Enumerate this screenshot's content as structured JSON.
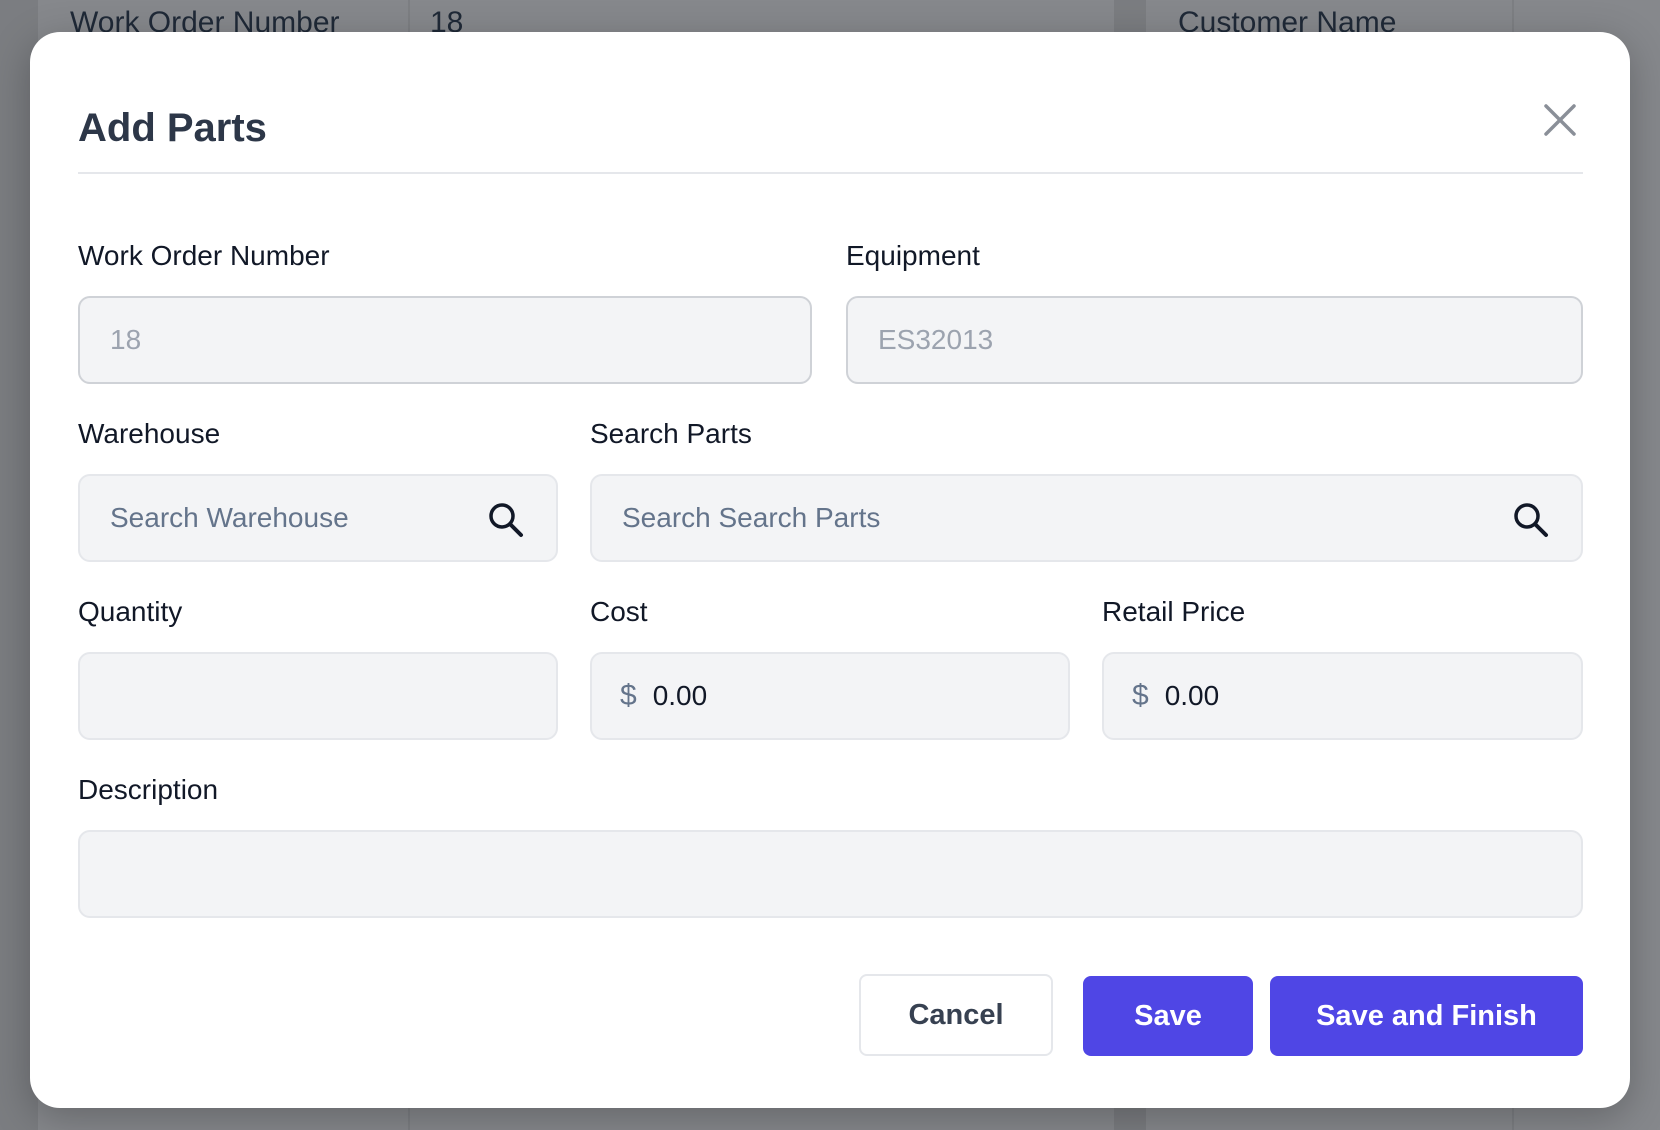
{
  "background": {
    "left_label": "Work Order Number",
    "left_value": "18",
    "right_label": "Customer Name"
  },
  "modal": {
    "title": "Add Parts",
    "close_icon": "close-icon",
    "fields": {
      "work_order_number": {
        "label": "Work Order Number",
        "value": "18",
        "disabled": true
      },
      "equipment": {
        "label": "Equipment",
        "value": "ES32013",
        "disabled": true
      },
      "warehouse": {
        "label": "Warehouse",
        "placeholder": "Search Warehouse",
        "icon": "search-icon"
      },
      "search_parts": {
        "label": "Search Parts",
        "placeholder": "Search Search Parts",
        "icon": "search-icon"
      },
      "quantity": {
        "label": "Quantity",
        "value": ""
      },
      "cost": {
        "label": "Cost",
        "currency_symbol": "$",
        "value": "0.00"
      },
      "retail_price": {
        "label": "Retail Price",
        "currency_symbol": "$",
        "value": "0.00"
      },
      "description": {
        "label": "Description",
        "value": ""
      }
    },
    "buttons": {
      "cancel": "Cancel",
      "save": "Save",
      "save_and_finish": "Save and Finish"
    }
  },
  "colors": {
    "primary": "#4f46e5",
    "overlay": "#7b7d81",
    "field_bg": "#f3f4f6"
  }
}
